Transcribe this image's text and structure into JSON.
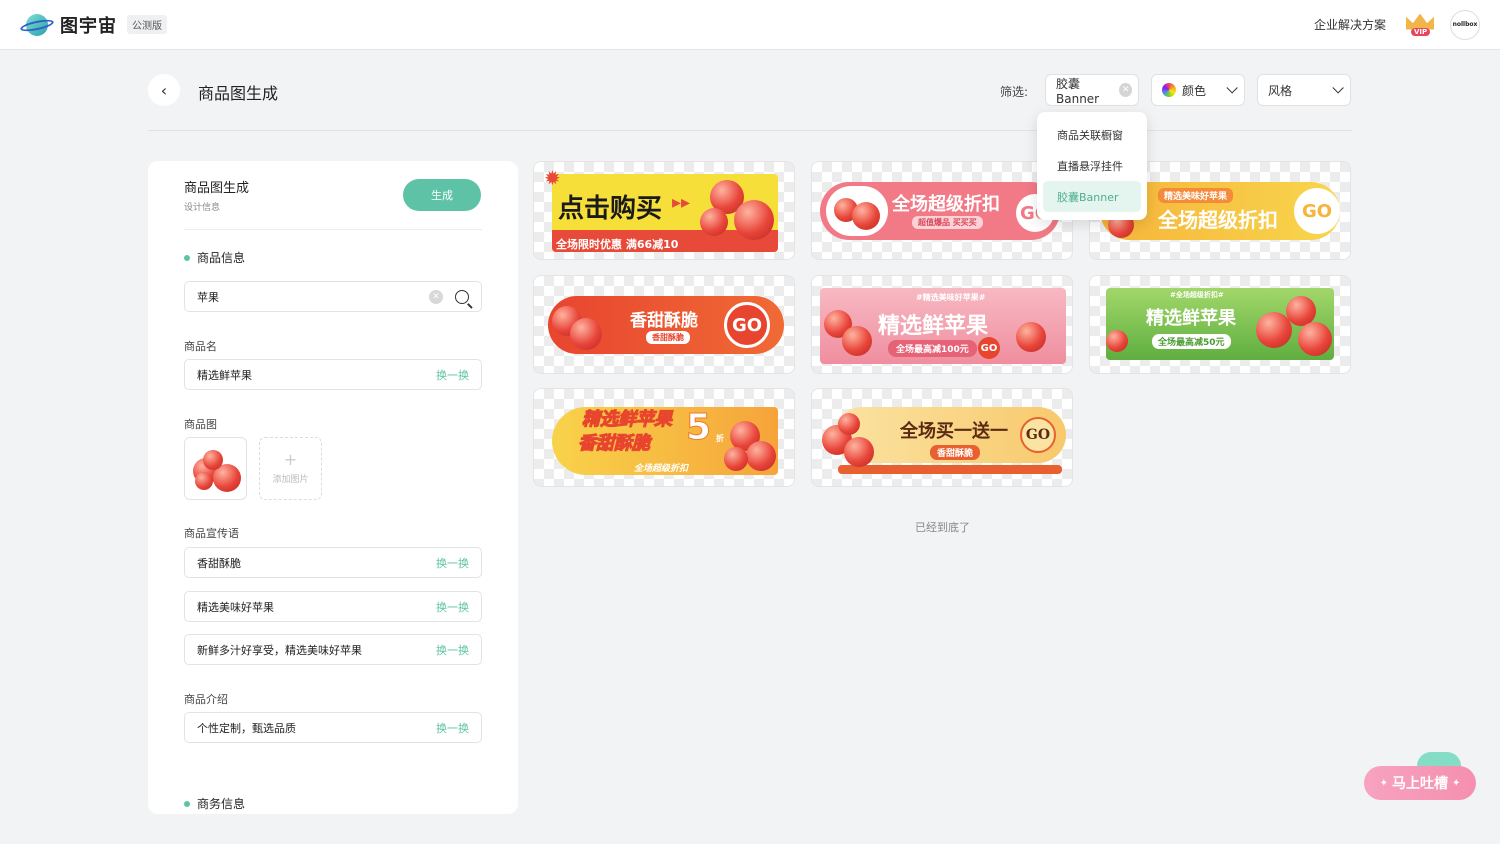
{
  "header": {
    "brand": "图宇宙",
    "beta": "公测版",
    "enterprise": "企业解决方案",
    "vip": "VIP",
    "user": "nollbox"
  },
  "page": {
    "title": "商品图生成"
  },
  "filter": {
    "label": "筛选:",
    "chip1": "胶囊Banner",
    "chip2": "颜色",
    "chip3": "风格",
    "dropdown": [
      "商品关联橱窗",
      "直播悬浮挂件",
      "胶囊Banner"
    ]
  },
  "panel": {
    "title": "商品图生成",
    "subtitle": "设计信息",
    "generate": "生成",
    "section_product": "商品信息",
    "search_value": "苹果",
    "name_label": "商品名",
    "name_value": "精选鲜苹果",
    "image_label": "商品图",
    "add_image": "添加图片",
    "slogan_label": "商品宣传语",
    "slogans": [
      "香甜酥脆",
      "精选美味好苹果",
      "新鲜多汁好享受，精选美味好苹果"
    ],
    "intro_label": "商品介绍",
    "intro_value": "个性定制，甄选品质",
    "swap": "换一换",
    "section_business": "商务信息"
  },
  "cards": {
    "c1": {
      "title": "点击购买",
      "sub": "全场限时优惠 满66减10"
    },
    "c2": {
      "title": "全场超级折扣",
      "sub": "超值爆品 买买买",
      "go": "GO"
    },
    "c3": {
      "tag": "精选美味好苹果",
      "title": "全场超级折扣",
      "go": "GO"
    },
    "c4": {
      "title": "香甜酥脆",
      "sub": "香甜酥脆",
      "go": "GO"
    },
    "c5": {
      "tag": "#精选美味好苹果#",
      "title": "精选鲜苹果",
      "sub": "全场最高减100元",
      "go": "GO"
    },
    "c6": {
      "tag": "#全场超级折扣#",
      "title": "精选鲜苹果",
      "sub": "全场最高减50元"
    },
    "c7": {
      "title1": "精选鲜苹果",
      "title2": "香甜酥脆",
      "num": "5",
      "unit": "折",
      "sub": "全场超级折扣"
    },
    "c8": {
      "title": "全场买一送一",
      "sub": "香甜酥脆",
      "go": "GO"
    }
  },
  "end_text": "已经到底了",
  "feedback": "马上吐槽"
}
